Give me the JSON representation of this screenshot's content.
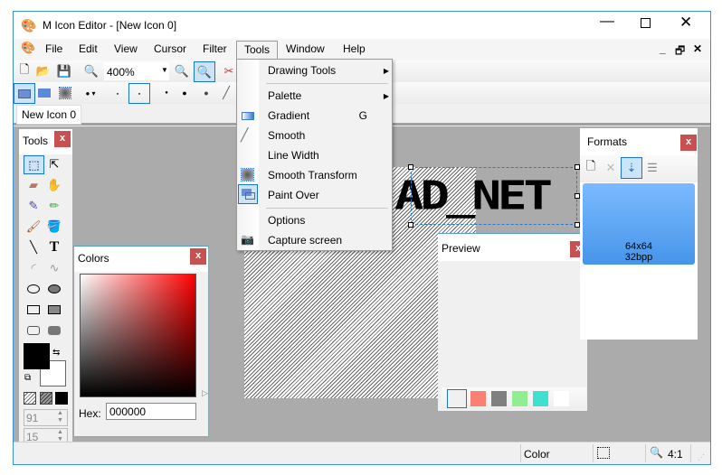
{
  "window": {
    "title": "M Icon Editor - [New Icon 0]"
  },
  "menubar": [
    "File",
    "Edit",
    "View",
    "Cursor",
    "Filter",
    "Tools",
    "Window",
    "Help"
  ],
  "toolbar": {
    "zoom": "400%"
  },
  "tabs": [
    "New Icon 0"
  ],
  "tools_menu": {
    "items": [
      {
        "label": "Drawing Tools",
        "submenu": true
      },
      {
        "label": "Palette",
        "submenu": true
      },
      {
        "label": "Gradient",
        "shortcut": "G",
        "icon": "gradient-icon"
      },
      {
        "label": "Smooth",
        "icon": "smooth-icon"
      },
      {
        "label": "Line Width"
      },
      {
        "label": "Smooth Transform",
        "icon": "smooth-transform-icon"
      },
      {
        "label": "Paint Over",
        "icon": "paint-over-icon"
      },
      {
        "label": "Options"
      },
      {
        "label": "Capture screen",
        "icon": "camera-icon"
      }
    ]
  },
  "tools_panel": {
    "title": "Tools",
    "close": "x",
    "width_value": "91",
    "height_value": "15"
  },
  "colors_panel": {
    "title": "Colors",
    "close": "x",
    "hex_label": "Hex:",
    "hex_value": "000000"
  },
  "canvas": {
    "text": "AD_NET"
  },
  "preview_panel": {
    "title": "Preview",
    "close": "x",
    "swatches": [
      "#f0f0f0",
      "#fa8072",
      "#808080",
      "#90ee90",
      "#40e0d0",
      "#ffffff"
    ]
  },
  "formats_panel": {
    "title": "Formats",
    "close": "x",
    "format_size": "64x64",
    "format_depth": "32bpp"
  },
  "status": {
    "mode": "Color",
    "zoom": "4:1"
  }
}
